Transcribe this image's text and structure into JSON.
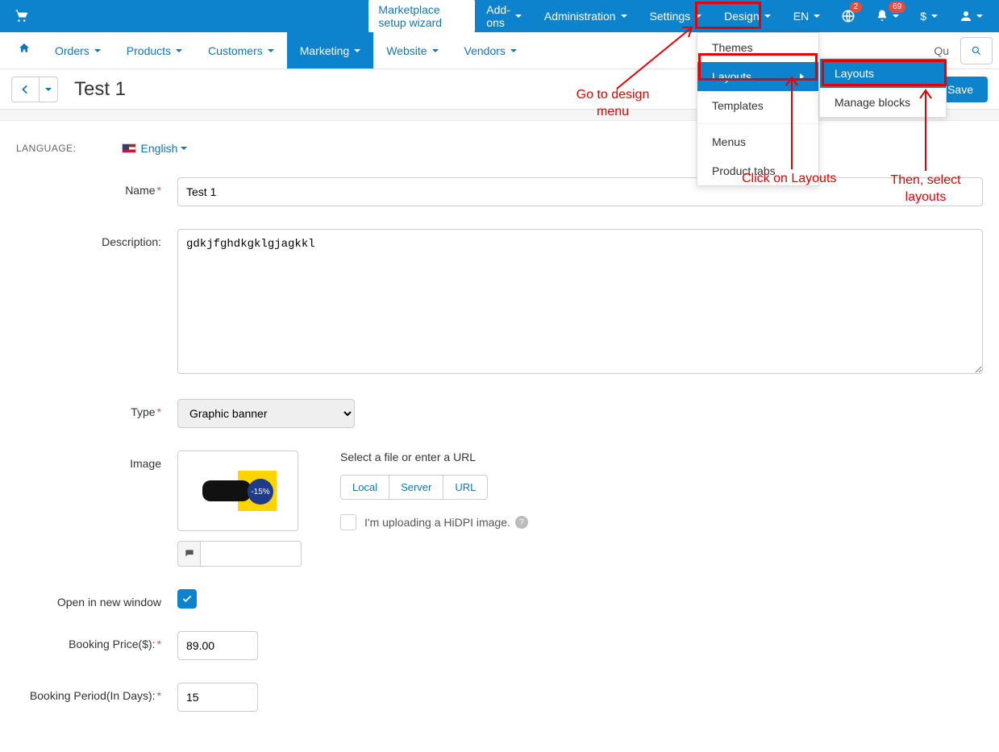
{
  "topbar": {
    "setup_wizard": "Marketplace setup wizard",
    "menu": {
      "addons": "Add-ons",
      "administration": "Administration",
      "settings": "Settings",
      "design": "Design",
      "lang": "EN",
      "currency": "$"
    },
    "badges": {
      "globe": "2",
      "bell": "69"
    }
  },
  "nav": {
    "orders": "Orders",
    "products": "Products",
    "customers": "Customers",
    "marketing": "Marketing",
    "website": "Website",
    "vendors": "Vendors",
    "quick_prefix": "Qu"
  },
  "titlebar": {
    "page_title": "Test 1",
    "save": "Save"
  },
  "lang": {
    "label": "LANGUAGE:",
    "value": "English"
  },
  "form": {
    "name_label": "Name",
    "name_value": "Test 1",
    "description_label": "Description:",
    "description_value": "gdkjfghdkgklgjagkkl",
    "type_label": "Type",
    "type_value": "Graphic banner",
    "image_label": "Image",
    "upload_hint": "Select a file or enter a URL",
    "tab_local": "Local",
    "tab_server": "Server",
    "tab_url": "URL",
    "hidpi_label": "I'm uploading a HiDPI image.",
    "open_new_window_label": "Open in new window",
    "booking_price_label": "Booking Price($):",
    "booking_price_value": "89.00",
    "booking_period_label": "Booking Period(In Days):",
    "booking_period_value": "15"
  },
  "dropdown1": {
    "themes": "Themes",
    "layouts": "Layouts",
    "templates": "Templates",
    "menus": "Menus",
    "product_tabs": "Product tabs"
  },
  "dropdown2": {
    "layouts": "Layouts",
    "manage_blocks": "Manage blocks"
  },
  "annotations": {
    "design_menu": "Go to design\nmenu",
    "click_layouts": "Click on Layouts",
    "select_layouts": "Then, select\nlayouts"
  }
}
